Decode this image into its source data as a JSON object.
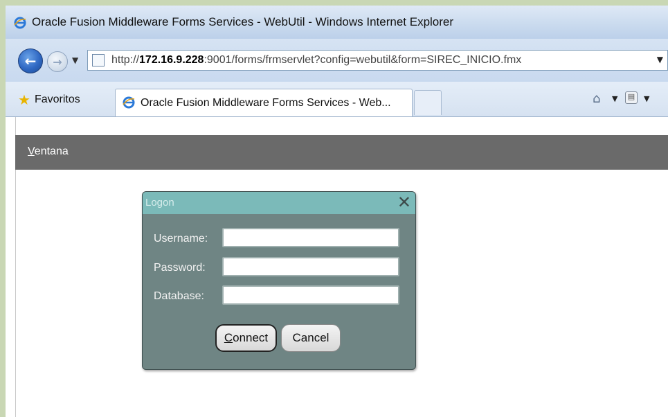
{
  "window": {
    "title": "Oracle Fusion Middleware Forms Services - WebUtil - Windows Internet Explorer"
  },
  "address_bar": {
    "url_prefix": "http://",
    "url_host": "172.16.9.228",
    "url_rest": ":9001/forms/frmservlet?config=webutil&form=SIREC_INICIO.fmx"
  },
  "favorites": {
    "label": "Favoritos"
  },
  "tabs": [
    {
      "label": "Oracle Fusion Middleware Forms Services - Web..."
    }
  ],
  "menu": {
    "ventana_first": "V",
    "ventana_rest": "entana"
  },
  "logon": {
    "title": "Logon",
    "username_label": "Username:",
    "password_label": "Password:",
    "database_label": "Database:",
    "username_value": "",
    "password_value": "",
    "database_value": "",
    "connect_first": "C",
    "connect_rest": "onnect",
    "cancel_label": "Cancel"
  },
  "icons": {
    "back": "back-arrow-icon",
    "forward": "forward-arrow-icon",
    "home": "home-icon",
    "feeds": "rss-feed-icon",
    "close": "close-icon",
    "favorites": "star-icon",
    "browser": "internet-explorer-icon"
  },
  "colors": {
    "dialog_body": "#6f8584",
    "dialog_titlebar": "#7bbab9",
    "menu_bar": "#6a6a6a"
  }
}
